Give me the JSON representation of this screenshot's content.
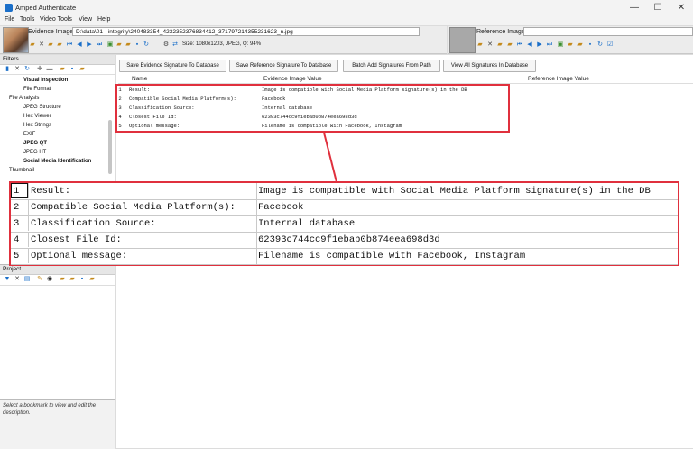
{
  "window": {
    "title": "Amped Authenticate",
    "min": "—",
    "max": "☐",
    "close": "✕"
  },
  "menu": [
    "File",
    "Tools",
    "Video Tools",
    "View",
    "Help"
  ],
  "evidence": {
    "label": "Evidence Image:",
    "path": "D:\\data\\01 - integrity\\240483354_4232352376834412_3717972143552316​23_n.jpg",
    "size_info": "Size: 1080x1203, JPEG, Q: 94%"
  },
  "reference": {
    "label": "Reference Image:"
  },
  "filters": {
    "header": "Filters",
    "items": [
      {
        "label": "Visual Inspection",
        "bold": true,
        "indent": 2
      },
      {
        "label": "File Format",
        "bold": false,
        "indent": 2
      },
      {
        "label": "File Analysis",
        "bold": false,
        "indent": 1
      },
      {
        "label": "JPEG Structure",
        "bold": false,
        "indent": 2
      },
      {
        "label": "Hex Viewer",
        "bold": false,
        "indent": 2
      },
      {
        "label": "Hex Strings",
        "bold": false,
        "indent": 2
      },
      {
        "label": "EXIF",
        "bold": false,
        "indent": 2
      },
      {
        "label": "JPEG QT",
        "bold": true,
        "indent": 2
      },
      {
        "label": "JPEG HT",
        "bold": false,
        "indent": 2
      },
      {
        "label": "Social Media Identification",
        "bold": true,
        "indent": 2
      },
      {
        "label": "Thumbnail",
        "bold": false,
        "indent": 1
      }
    ]
  },
  "project": {
    "header": "Project",
    "description": "Select a bookmark to view and edit the description."
  },
  "buttons": {
    "save_evidence": "Save Evidence Signature To Database",
    "save_reference": "Save Reference Signature To Database",
    "batch_add": "Batch Add Signatures From Path",
    "view_all": "View All Signatures In Database"
  },
  "columns": {
    "name": "Name",
    "evidence": "Evidence Image Value",
    "reference": "Reference Image Value"
  },
  "rows": [
    {
      "num": "1",
      "name": "Result:",
      "value": "Image is compatible with Social Media Platform signature(s) in the DB"
    },
    {
      "num": "2",
      "name": "Compatible Social Media Platform(s):",
      "value": "Facebook"
    },
    {
      "num": "3",
      "name": "Classification Source:",
      "value": "Internal database"
    },
    {
      "num": "4",
      "name": "Closest File Id:",
      "value": "62393c744cc9f1ebab0b874eea698d3d"
    },
    {
      "num": "5",
      "name": "Optional message:",
      "value": "Filename is compatible with Facebook, Instagram"
    }
  ],
  "colors": {
    "highlight": "#e0303d",
    "accent": "#1b6fc9"
  }
}
